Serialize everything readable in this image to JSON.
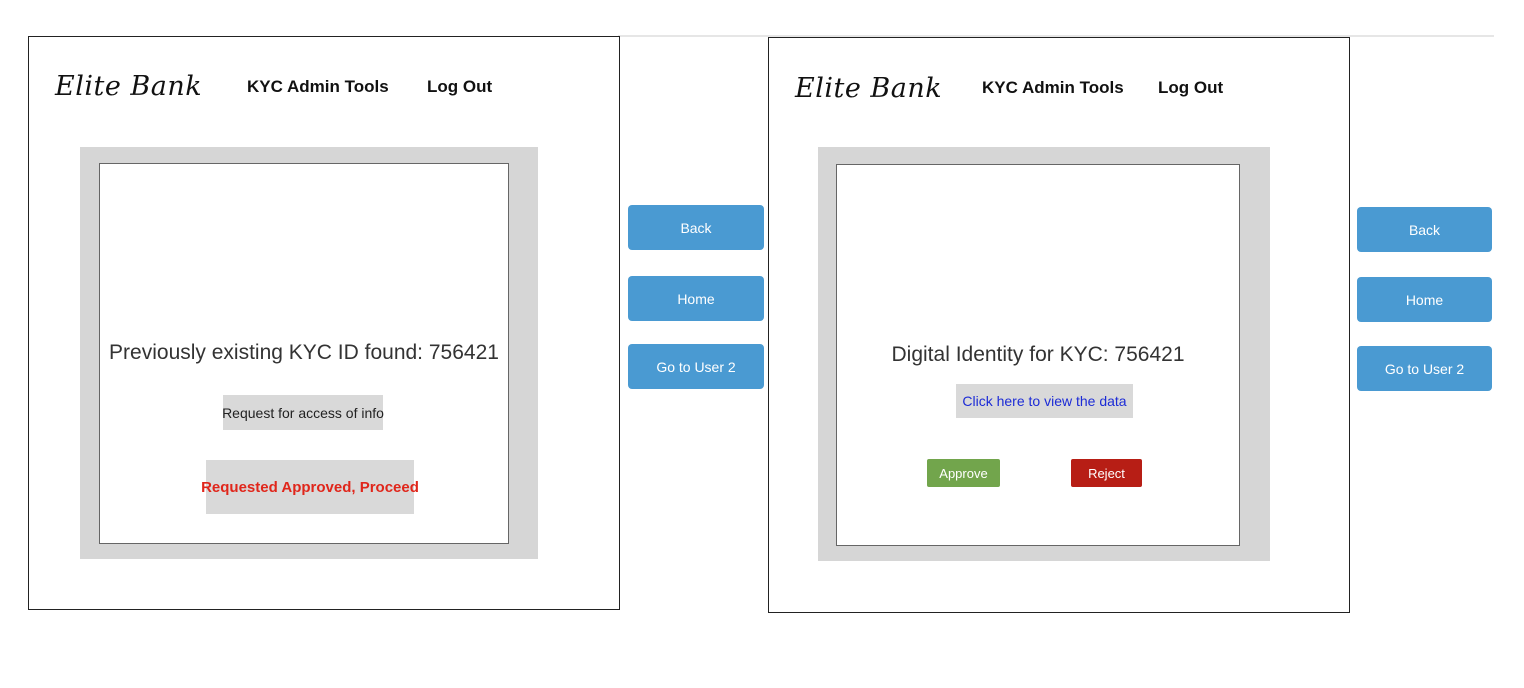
{
  "brand": "Elite Bank",
  "nav": {
    "admin_tools": "KYC Admin Tools",
    "logout": "Log Out"
  },
  "screen1": {
    "message": "Previously existing KYC ID found: 756421",
    "request_button": "Request for access of info",
    "status_button": "Requested Approved, Proceed"
  },
  "screen2": {
    "message": "Digital Identity for KYC: 756421",
    "view_data_button": "Click here to view the data",
    "approve_button": "Approve",
    "reject_button": "Reject"
  },
  "side_nav": {
    "back": "Back",
    "home": "Home",
    "go_to_user": "Go to User 2"
  },
  "colors": {
    "side_button": "#4a9ad2",
    "approve": "#72a54c",
    "reject": "#b71e15",
    "status_text": "#e0261b",
    "link_text": "#1c2bd6",
    "frame": "#d6d6d6"
  }
}
